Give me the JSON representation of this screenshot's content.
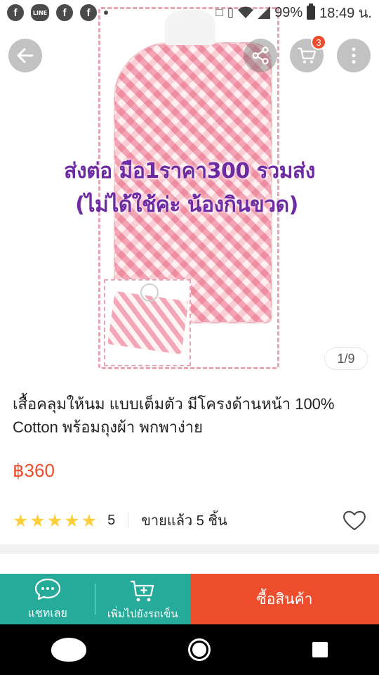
{
  "status_bar": {
    "battery": "99%",
    "time": "18:49 น.",
    "left_icons": [
      "facebook-icon",
      "line-icon",
      "facebook-icon",
      "facebook-icon"
    ],
    "line_label": "LINE"
  },
  "hero": {
    "overlay_line1": "ส่งต่อ มือ1ราคา300 รวมส่ง",
    "overlay_line2": "(ไม่ได้ใช้ค่ะ น้องกินขวด)",
    "pager": "1/9",
    "cart_count": "3"
  },
  "product": {
    "title": "เสื้อคลุมให้นม แบบเต็มตัว มีโครงด้านหน้า 100% Cotton พร้อมถุงผ้า พกพาง่าย",
    "price": "฿360",
    "rating": "5",
    "stars": 5,
    "sold": "ขายแล้ว 5 ชิ้น"
  },
  "actions": {
    "chat_label": "แชทเลย",
    "add_to_cart_label": "เพิ่มไปยังรถเข็น",
    "buy_label": "ซื้อสินค้า"
  },
  "colors": {
    "accent": "#ee4d2d",
    "teal": "#26aa99",
    "star": "#ffce3d",
    "overlay_text": "#6e2aa2"
  }
}
